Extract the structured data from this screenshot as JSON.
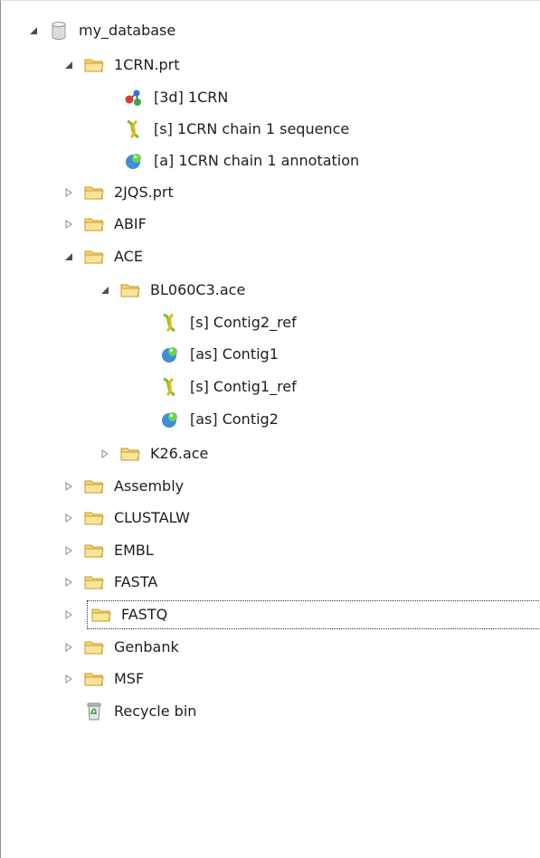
{
  "tree": {
    "root": {
      "label": "my_database",
      "icon": "database-icon",
      "expanded": true
    },
    "items": [
      {
        "label": "1CRN.prt",
        "icon": "folder-icon",
        "expanded": true
      },
      {
        "label": "[3d] 1CRN",
        "icon": "molecule-3d-icon"
      },
      {
        "label": "[s] 1CRN chain 1 sequence",
        "icon": "sequence-icon"
      },
      {
        "label": "[a] 1CRN chain 1 annotation",
        "icon": "annotation-icon"
      },
      {
        "label": "2JQS.prt",
        "icon": "folder-icon",
        "expanded": false
      },
      {
        "label": "ABIF",
        "icon": "folder-icon",
        "expanded": false
      },
      {
        "label": "ACE",
        "icon": "folder-icon",
        "expanded": true
      },
      {
        "label": "BL060C3.ace",
        "icon": "folder-icon",
        "expanded": true
      },
      {
        "label": "[s] Contig2_ref",
        "icon": "sequence-icon"
      },
      {
        "label": "[as] Contig1",
        "icon": "annotation-icon"
      },
      {
        "label": "[s] Contig1_ref",
        "icon": "sequence-icon"
      },
      {
        "label": "[as] Contig2",
        "icon": "annotation-icon"
      },
      {
        "label": "K26.ace",
        "icon": "folder-icon",
        "expanded": false
      },
      {
        "label": "Assembly",
        "icon": "folder-icon",
        "expanded": false
      },
      {
        "label": "CLUSTALW",
        "icon": "folder-icon",
        "expanded": false
      },
      {
        "label": "EMBL",
        "icon": "folder-icon",
        "expanded": false
      },
      {
        "label": "FASTA",
        "icon": "folder-icon",
        "expanded": false
      },
      {
        "label": "FASTQ",
        "icon": "folder-icon",
        "expanded": false,
        "focused": true
      },
      {
        "label": "Genbank",
        "icon": "folder-icon",
        "expanded": false
      },
      {
        "label": "MSF",
        "icon": "folder-icon",
        "expanded": false
      },
      {
        "label": "Recycle bin",
        "icon": "recycle-bin-icon"
      }
    ]
  },
  "colors": {
    "folder_fill": "#f7d774",
    "folder_stroke": "#c89a2a",
    "arrow": "#8a8a8a",
    "focus_outline": "#333333"
  }
}
